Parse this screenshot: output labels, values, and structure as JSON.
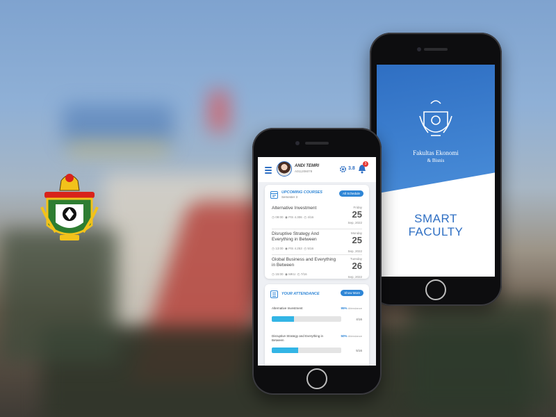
{
  "colors": {
    "primary": "#2f6fc3",
    "accent": "#2f86d6",
    "progress": "#33b5e5",
    "badge": "#e53935"
  },
  "splash": {
    "faculty_line1": "Fakultas Ekonomi",
    "faculty_line2": "& Bisnis",
    "app_line1": "SMART",
    "app_line2": "FACULTY"
  },
  "header": {
    "name": "ANDI TEMRI",
    "nim": "A011206078",
    "gpa": "3.8",
    "notifications": "3"
  },
  "courses_card": {
    "title": "UPCOMING COURSES",
    "subtitle": "Semester 3",
    "button": "All Schedule",
    "items": [
      {
        "name": "Alternative Investment",
        "time": "09:00",
        "room": "FIS 4.306",
        "count": "4/16",
        "weekday": "Friday",
        "day": "25",
        "month": "Sep, 2022"
      },
      {
        "name": "Disruptive Strategy And Everything in Between",
        "time": "13:00",
        "room": "FIS 4.253",
        "count": "5/16",
        "weekday": "Monday",
        "day": "25",
        "month": "Sep, 2022"
      },
      {
        "name": "Global Business and Everything in Between",
        "time": "15:00",
        "room": "MKU",
        "count": "7/16",
        "weekday": "Tuesday",
        "day": "26",
        "month": "Sep, 2022"
      }
    ]
  },
  "attendance_card": {
    "title": "YOUR ATTENDANCE",
    "button": "Show More",
    "items": [
      {
        "name": "Alternative Investment",
        "percent": "95%",
        "percent_label": "Attendance",
        "count": "4/16",
        "progress": 0.32,
        "dots": [
          "#2fa7a0",
          "#2fa7a0",
          "#2fa7a0",
          "#2fa7a0"
        ]
      },
      {
        "name": "Disruptive Strategy and Everything in Between",
        "percent": "50%",
        "percent_label": "Attendance",
        "count": "5/16",
        "progress": 0.38,
        "dots": [
          "#2fa7a0",
          "#2fa7a0",
          "#e53935",
          "#2fa7a0",
          "#2fa7a0"
        ]
      }
    ]
  },
  "icons": [
    "menu-icon",
    "gear-icon",
    "bell-icon",
    "calendar-icon",
    "clock-icon",
    "location-icon",
    "count-icon",
    "attendance-icon"
  ]
}
